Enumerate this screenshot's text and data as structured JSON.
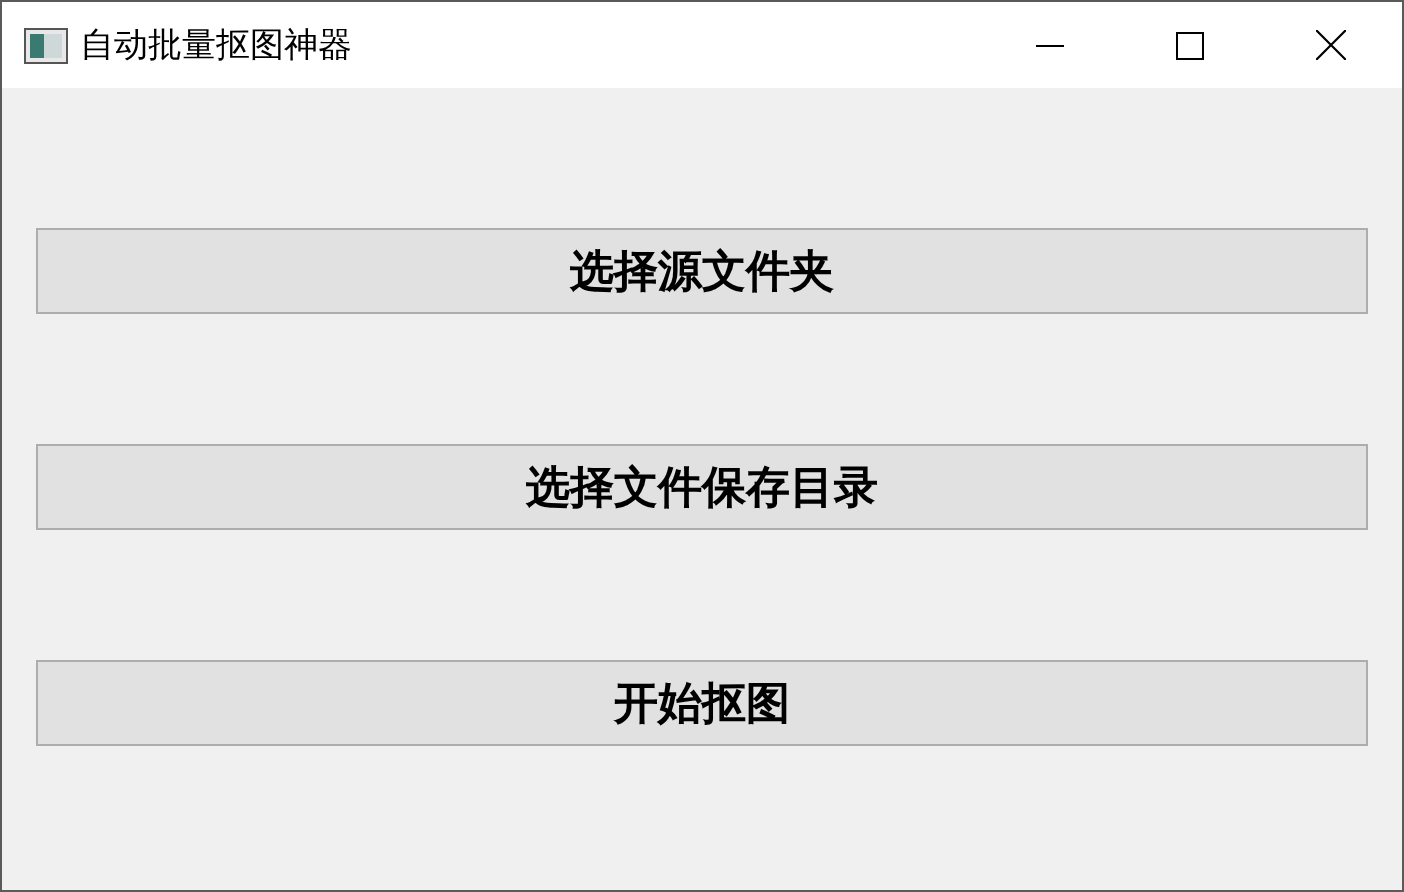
{
  "window": {
    "title": "自动批量抠图神器"
  },
  "buttons": [
    "选择源文件夹",
    "选择文件保存目录",
    "开始抠图"
  ]
}
